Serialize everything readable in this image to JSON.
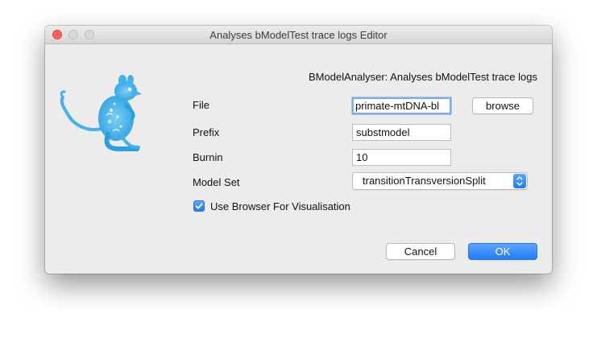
{
  "window": {
    "title": "Analyses bModelTest trace logs Editor"
  },
  "header": {
    "text": "BModelAnalyser: Analyses bModelTest trace logs"
  },
  "form": {
    "file_label": "File",
    "file_value": "primate-mtDNA-bl",
    "browse_label": "browse",
    "prefix_label": "Prefix",
    "prefix_value": "substmodel",
    "burnin_label": "Burnin",
    "burnin_value": "10",
    "modelset_label": "Model Set",
    "modelset_value": "transitionTransversionSplit",
    "browser_checkbox_label": "Use Browser For Visualisation",
    "browser_checked": true
  },
  "footer": {
    "cancel_label": "Cancel",
    "ok_label": "OK"
  },
  "icons": {
    "mascot": "kangaroo-rat-icon",
    "close": "close-icon",
    "minimize": "minimize-icon",
    "maximize": "maximize-icon",
    "select_arrows": "up-down-arrows-icon",
    "check": "check-icon"
  },
  "colors": {
    "accent": "#1f7ef8",
    "mascot": "#43b1ec",
    "window_bg": "#ececec"
  }
}
